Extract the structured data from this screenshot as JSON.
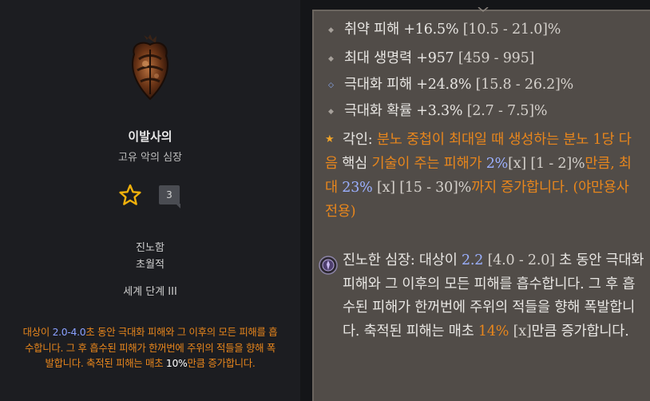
{
  "left_panel": {
    "item_name": "이발사의",
    "item_type": "고유 악의 심장",
    "quantity": "3",
    "tag_1": "진노함",
    "tag_2": "초월적",
    "world_tier": "세계 단계 III",
    "description": {
      "p1": "대상이 ",
      "p2": "2.0-4.0",
      "p3": "초 동안 극대화 피해와 그 이후의 모든 피해를 흡수합니다. 그 후 흡수된 피해가 한꺼번에 주위의 적들을 향해 폭발합니다. 축적된 피해는 매초 ",
      "p4": "10%",
      "p5": "만큼 증가합니다."
    }
  },
  "tooltip": {
    "affixes": [
      {
        "text": "취약 피해 +16.5% ",
        "range": "[10.5 - 21.0]%"
      },
      {
        "text": "최대 생명력 +957 ",
        "range": "[459 - 995]"
      },
      {
        "text": "극대화 피해 +24.8% ",
        "range": "[15.8 - 26.2]%"
      },
      {
        "text": "극대화 확률 +3.3% ",
        "range": "[2.7 - 7.5]%"
      }
    ],
    "aspect": {
      "label": "각인: ",
      "t1": "분노 중첩이 최대일 때 생성하는 분노 1당 다음 ",
      "t2": "핵심",
      "t3": " 기술이 주는 피해가 ",
      "v1": "2%",
      "r1": "[x] [1 - 2]%",
      "t4": "만큼, 최대 ",
      "v2": "23%",
      "r2": "[x] [15 - 30]%",
      "t5": "까지 증가합니다. (야만용사 전용)"
    },
    "malignant": {
      "label": "진노한 심장: ",
      "t1": "대상이 ",
      "v1": "2.2",
      "r1": " [4.0 - 2.0]",
      "t2": " 초 동안 극대화 피해와 그 이후의 모든 피해를 흡수합니다. 그 후 흡수된 피해가 한꺼번에 주위의 적들을 향해 폭발합니다. 축적된 피해는 매초 ",
      "v2": "14%",
      "r2": "[x]",
      "t3": "만큼 증가합니다."
    }
  },
  "colors": {
    "orange": "#e8861c",
    "blue_value": "#9bb0ff",
    "tooltip_bg": "#514c48",
    "panel_bg": "#1c1d21",
    "star": "#f1b10b"
  },
  "icons": {
    "heart": "malignant-heart-icon",
    "favorite": "star-outline-icon",
    "aspect": "star-icon",
    "malignant": "wrathful-heart-socket-icon"
  }
}
